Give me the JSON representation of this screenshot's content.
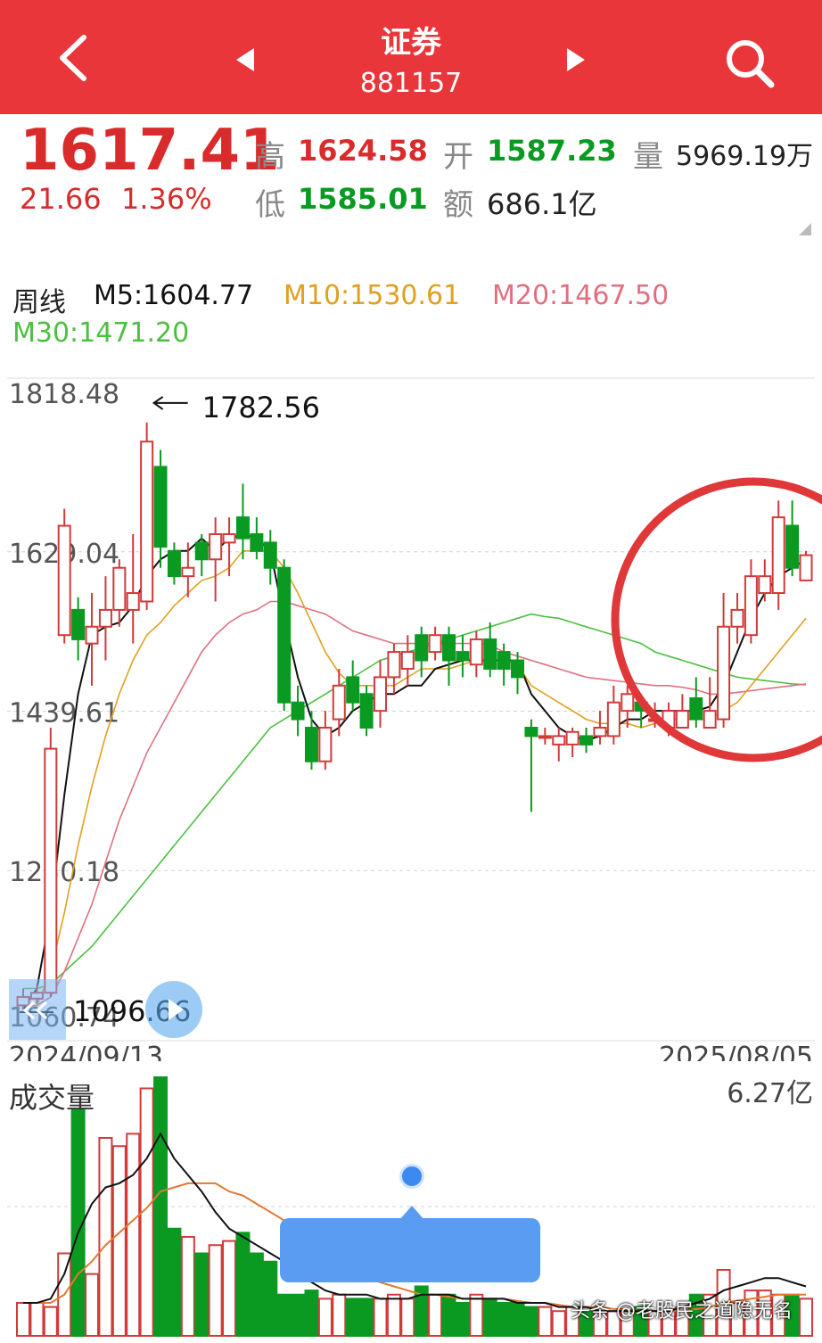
{
  "header": {
    "title": "证券",
    "code": "881157",
    "back_icon": "chevron-left-icon",
    "prev_icon": "triangle-left-icon",
    "next_icon": "triangle-right-icon",
    "search_icon": "search-icon"
  },
  "quote": {
    "price": "1617.41",
    "change": "21.66",
    "change_pct": "1.36%",
    "high_label": "高",
    "high": "1624.58",
    "open_label": "开",
    "open": "1587.23",
    "volume_label": "量",
    "volume": "5969.19万",
    "low_label": "低",
    "low": "1585.01",
    "amount_label": "额",
    "amount": "686.1亿"
  },
  "ma_legend": {
    "period": "周线",
    "m5": "M5:1604.77",
    "m10": "M10:1530.61",
    "m20": "M20:1467.50",
    "m30": "M30:1471.20",
    "colors": {
      "m5": "#111111",
      "m10": "#e0a020",
      "m20": "#e07080",
      "m30": "#4cc040"
    }
  },
  "chart_data": [
    {
      "type": "candlestick",
      "y_ticks": [
        "1818.48",
        "1629.04",
        "1439.61",
        "1250.18",
        "1060.74"
      ],
      "ylim": [
        1060.74,
        1818.48
      ],
      "high_annotation": "1782.56",
      "low_annotation": "1096.66",
      "x_start": "2024/09/13",
      "x_end": "2025/08/05",
      "candles": [
        [
          1090,
          1100,
          1085,
          1110
        ],
        [
          1098,
          1105,
          1092,
          1115
        ],
        [
          1105,
          1395,
          1100,
          1420
        ],
        [
          1530,
          1660,
          1520,
          1680
        ],
        [
          1560,
          1525,
          1500,
          1575
        ],
        [
          1520,
          1540,
          1470,
          1580
        ],
        [
          1540,
          1560,
          1500,
          1600
        ],
        [
          1560,
          1610,
          1540,
          1620
        ],
        [
          1560,
          1580,
          1520,
          1650
        ],
        [
          1570,
          1760,
          1560,
          1782.56
        ],
        [
          1730,
          1635,
          1610,
          1750
        ],
        [
          1630,
          1600,
          1590,
          1640
        ],
        [
          1600,
          1610,
          1575,
          1640
        ],
        [
          1640,
          1620,
          1600,
          1650
        ],
        [
          1620,
          1650,
          1570,
          1670
        ],
        [
          1640,
          1650,
          1600,
          1670
        ],
        [
          1670,
          1645,
          1620,
          1710
        ],
        [
          1650,
          1630,
          1620,
          1670
        ],
        [
          1640,
          1610,
          1590,
          1655
        ],
        [
          1610,
          1450,
          1440,
          1620
        ],
        [
          1450,
          1430,
          1410,
          1470
        ],
        [
          1420,
          1380,
          1370,
          1440
        ],
        [
          1380,
          1420,
          1370,
          1440
        ],
        [
          1430,
          1470,
          1410,
          1490
        ],
        [
          1480,
          1450,
          1440,
          1500
        ],
        [
          1460,
          1420,
          1410,
          1470
        ],
        [
          1440,
          1480,
          1420,
          1500
        ],
        [
          1480,
          1510,
          1460,
          1520
        ],
        [
          1490,
          1510,
          1470,
          1530
        ],
        [
          1530,
          1500,
          1480,
          1540
        ],
        [
          1510,
          1530,
          1500,
          1540
        ],
        [
          1530,
          1500,
          1470,
          1540
        ],
        [
          1510,
          1500,
          1480,
          1530
        ],
        [
          1495,
          1525,
          1480,
          1535
        ],
        [
          1525,
          1490,
          1480,
          1545
        ],
        [
          1510,
          1490,
          1470,
          1520
        ],
        [
          1500,
          1480,
          1460,
          1510
        ],
        [
          1420,
          1410,
          1320,
          1430
        ],
        [
          1410,
          1410,
          1400,
          1420
        ],
        [
          1400,
          1410,
          1380,
          1420
        ],
        [
          1400,
          1415,
          1385,
          1420
        ],
        [
          1410,
          1400,
          1390,
          1420
        ],
        [
          1410,
          1420,
          1400,
          1440
        ],
        [
          1410,
          1450,
          1400,
          1470
        ],
        [
          1440,
          1460,
          1420,
          1470
        ],
        [
          1450,
          1440,
          1420,
          1460
        ],
        [
          1430,
          1430,
          1420,
          1450
        ],
        [
          1420,
          1440,
          1410,
          1450
        ],
        [
          1420,
          1440,
          1420,
          1460
        ],
        [
          1455,
          1430,
          1420,
          1480
        ],
        [
          1420,
          1440,
          1420,
          1480
        ],
        [
          1430,
          1540,
          1420,
          1580
        ],
        [
          1540,
          1560,
          1520,
          1580
        ],
        [
          1530,
          1600,
          1520,
          1620
        ],
        [
          1580,
          1600,
          1570,
          1620
        ],
        [
          1580,
          1670,
          1560,
          1690
        ],
        [
          1660,
          1610,
          1600,
          1690
        ],
        [
          1595,
          1625,
          1595,
          1630
        ]
      ],
      "m5": [
        1085,
        1110,
        1200,
        1340,
        1460,
        1530,
        1540,
        1545,
        1565,
        1600,
        1620,
        1630,
        1630,
        1645,
        1630,
        1645,
        1650,
        1645,
        1630,
        1550,
        1480,
        1430,
        1410,
        1420,
        1440,
        1450,
        1460,
        1460,
        1470,
        1470,
        1490,
        1495,
        1500,
        1500,
        1500,
        1500,
        1500,
        1460,
        1440,
        1420,
        1410,
        1405,
        1410,
        1420,
        1430,
        1430,
        1440,
        1440,
        1440,
        1440,
        1445,
        1470,
        1510,
        1550,
        1580,
        1600,
        1610,
        1620
      ],
      "m10": [
        1085,
        1090,
        1130,
        1200,
        1280,
        1350,
        1410,
        1460,
        1500,
        1530,
        1545,
        1565,
        1580,
        1595,
        1600,
        1610,
        1630,
        1630,
        1630,
        1610,
        1580,
        1545,
        1510,
        1485,
        1470,
        1470,
        1470,
        1470,
        1480,
        1490,
        1490,
        1490,
        1495,
        1500,
        1500,
        1500,
        1495,
        1470,
        1460,
        1450,
        1440,
        1430,
        1425,
        1425,
        1425,
        1420,
        1425,
        1430,
        1430,
        1430,
        1430,
        1440,
        1450,
        1470,
        1490,
        1510,
        1530,
        1550
      ],
      "m20": [
        1088,
        1090,
        1100,
        1130,
        1170,
        1210,
        1260,
        1310,
        1350,
        1390,
        1420,
        1450,
        1480,
        1510,
        1530,
        1545,
        1555,
        1560,
        1570,
        1570,
        1565,
        1560,
        1555,
        1545,
        1535,
        1530,
        1525,
        1520,
        1520,
        1520,
        1520,
        1520,
        1520,
        1520,
        1518,
        1510,
        1505,
        1500,
        1495,
        1490,
        1485,
        1480,
        1478,
        1476,
        1474,
        1472,
        1470,
        1470,
        1468,
        1465,
        1460,
        1460,
        1462,
        1464,
        1466,
        1468,
        1470,
        1472
      ],
      "m30": [
        1110,
        1110,
        1115,
        1130,
        1145,
        1160,
        1180,
        1200,
        1220,
        1240,
        1260,
        1280,
        1300,
        1320,
        1340,
        1360,
        1380,
        1400,
        1420,
        1430,
        1440,
        1450,
        1460,
        1470,
        1480,
        1490,
        1500,
        1505,
        1510,
        1515,
        1520,
        1525,
        1530,
        1535,
        1540,
        1545,
        1550,
        1555,
        1552,
        1550,
        1545,
        1540,
        1535,
        1530,
        1525,
        1520,
        1510,
        1505,
        1500,
        1495,
        1490,
        1485,
        1480,
        1478,
        1476,
        1474,
        1472,
        1471
      ]
    },
    {
      "type": "bar",
      "title": "成交量",
      "max_label": "6.27亿",
      "values": [
        0.8,
        0.8,
        0.7,
        2.0,
        5.5,
        1.5,
        4.8,
        4.6,
        4.9,
        6.0,
        6.27,
        2.6,
        2.4,
        2.0,
        2.2,
        2.3,
        2.5,
        2.0,
        1.8,
        1.0,
        1.0,
        1.1,
        0.9,
        1.0,
        0.9,
        0.9,
        0.9,
        1.0,
        0.9,
        1.2,
        1.0,
        1.0,
        0.8,
        1.0,
        0.9,
        0.8,
        0.8,
        0.7,
        0.7,
        0.6,
        0.7,
        0.6,
        0.6,
        0.6,
        0.6,
        0.7,
        0.6,
        0.6,
        0.7,
        1.0,
        1.0,
        1.6,
        0.8,
        1.1,
        1.1,
        1.0,
        1.0,
        0.9
      ],
      "ma5": [
        0.8,
        0.8,
        0.9,
        1.5,
        2.5,
        3.2,
        3.6,
        3.7,
        3.9,
        4.3,
        4.9,
        4.3,
        3.9,
        3.5,
        3.0,
        2.6,
        2.4,
        2.2,
        2.0,
        1.8,
        1.5,
        1.3,
        1.1,
        1.0,
        1.0,
        1.0,
        0.9,
        0.9,
        0.9,
        1.0,
        1.0,
        1.0,
        0.9,
        0.9,
        0.9,
        0.9,
        0.8,
        0.8,
        0.8,
        0.7,
        0.7,
        0.7,
        0.6,
        0.6,
        0.6,
        0.6,
        0.6,
        0.6,
        0.7,
        0.8,
        0.9,
        1.1,
        1.2,
        1.3,
        1.4,
        1.4,
        1.3,
        1.2
      ],
      "ma10": [
        0.8,
        0.8,
        0.8,
        1.0,
        1.5,
        1.8,
        2.2,
        2.5,
        2.8,
        3.1,
        3.5,
        3.6,
        3.7,
        3.7,
        3.7,
        3.5,
        3.4,
        3.2,
        3.0,
        2.8,
        2.5,
        2.2,
        2.0,
        1.8,
        1.6,
        1.4,
        1.3,
        1.2,
        1.1,
        1.0,
        1.0,
        0.95,
        0.9,
        0.9,
        0.9,
        0.9,
        0.85,
        0.8,
        0.8,
        0.75,
        0.7,
        0.7,
        0.7,
        0.65,
        0.65,
        0.6,
        0.6,
        0.6,
        0.6,
        0.65,
        0.7,
        0.8,
        0.85,
        0.9,
        0.95,
        1.0,
        1.0,
        1.0
      ]
    }
  ],
  "overlays": {
    "collapse_icon": "double-chevron-left-icon",
    "play_icon": "play-icon",
    "scroll_dot_icon": "dot-icon"
  },
  "watermark": "头条 @老股民之道隐无名"
}
